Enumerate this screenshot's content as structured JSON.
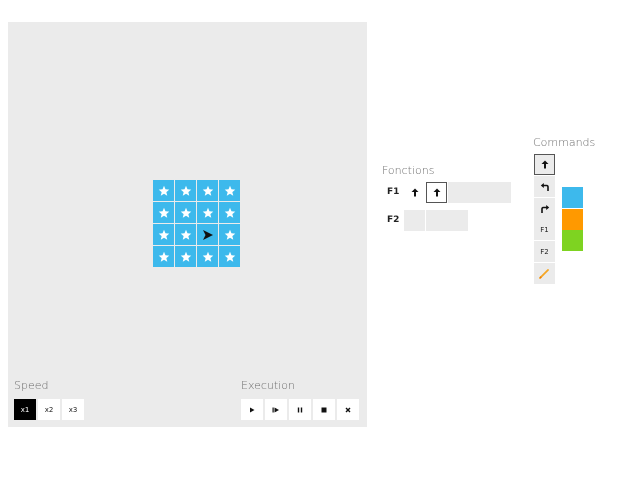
{
  "speed": {
    "title": "Speed",
    "options": [
      {
        "label": "x1",
        "active": true
      },
      {
        "label": "x2",
        "active": false
      },
      {
        "label": "x3",
        "active": false
      }
    ]
  },
  "execution": {
    "title": "Execution",
    "buttons": [
      "play-icon",
      "step-icon",
      "pause-icon",
      "stop-icon",
      "close-icon"
    ]
  },
  "board": {
    "rows": 4,
    "cols": 4,
    "cells": [
      [
        "star",
        "star",
        "star",
        "star"
      ],
      [
        "star",
        "star",
        "star",
        "star"
      ],
      [
        "star",
        "star",
        "robot",
        "star"
      ],
      [
        "star",
        "star",
        "star",
        "star"
      ]
    ],
    "robot_facing": "right",
    "cell_color": "#3db9ec"
  },
  "functions": {
    "title": "Fonctions",
    "list": [
      {
        "name": "F1",
        "slots": [
          "arrow-up-icon",
          "arrow-up-icon",
          "",
          "",
          ""
        ]
      },
      {
        "name": "F2",
        "slots": [
          "",
          "",
          ""
        ]
      }
    ]
  },
  "commands": {
    "title": "Commands",
    "items": [
      {
        "icon": "arrow-up-icon",
        "label": ""
      },
      {
        "icon": "turn-left-icon",
        "label": ""
      },
      {
        "icon": "turn-right-icon",
        "label": ""
      },
      {
        "icon": "",
        "label": "F1"
      },
      {
        "icon": "",
        "label": "F2"
      },
      {
        "icon": "pencil-icon",
        "label": ""
      }
    ],
    "colors": [
      "#3db9ec",
      "#ff9900",
      "#7ed321"
    ]
  }
}
